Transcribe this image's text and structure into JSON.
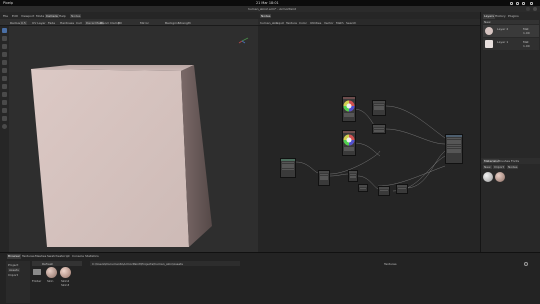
{
  "system_bar": {
    "app_menu": "Pixelp",
    "clock": "21 Mar 18:01"
  },
  "window": {
    "title": "human_skin2.arm* - ArmorPaint"
  },
  "menu": {
    "items": [
      "File",
      "Edit",
      "Viewport",
      "Mode",
      "Camera",
      "Help"
    ],
    "active_index": 4,
    "right_item": "Nodes",
    "search": "Search"
  },
  "tool_options": {
    "items": [
      "Radius",
      "0.5",
      "UV Layer",
      "Fade",
      "Hardness",
      "Cull",
      "Decal Mask",
      "Blend",
      "Clamp",
      "Fill"
    ],
    "right_items": [
      "Mirror",
      "Backgrnd",
      "Strength"
    ]
  },
  "node_editor": {
    "tabs": [
      "Nodes"
    ],
    "menu_items": [
      "human_skin",
      "Input",
      "Texture",
      "Color",
      "Utilities",
      "Vector",
      "Math",
      "Search"
    ],
    "active_tab": "Nodes"
  },
  "right_panel": {
    "tabs": [
      "Layers",
      "History",
      "Plugins"
    ],
    "layer_rows": [
      {
        "name": "Layer 2",
        "sub": "Mat",
        "opacity": "1.00"
      },
      {
        "name": "Layer 1",
        "sub": "Mat",
        "opacity": "1.00"
      }
    ],
    "materials_tabs": [
      "Materials",
      "Brushes",
      "Fonts"
    ],
    "materials_buttons": [
      "New",
      "Import",
      "Nodes"
    ]
  },
  "bottom_panel": {
    "tabs": [
      "Browser",
      "Textures",
      "Meshes",
      "Swatches",
      "Script",
      "Console",
      "Statistics"
    ],
    "active_index": 0,
    "left_buttons": [
      "Project",
      "Assets",
      "Import"
    ],
    "path_bar": "Refresh",
    "path": "C:\\Users\\Documents\\ArmorPaint\\Projects\\human_skin\\Assets",
    "status": "Textures",
    "files": [
      "Skin",
      "Skin2",
      "Skin3"
    ],
    "folder_label": "Folder"
  },
  "colors": {
    "background": "#1d1d1d",
    "panel": "#282828",
    "viewport": "#2e2e2e",
    "cube_face": "#d6c4c1",
    "accent": "#4a6fa5"
  },
  "icons": [
    "brush-icon",
    "eraser-icon",
    "fill-icon",
    "decal-icon",
    "text-icon",
    "clone-icon",
    "blur-icon",
    "smudge-icon",
    "particle-icon",
    "colorid-icon",
    "picker-icon",
    "bake-icon",
    "gizmo-icon",
    "folder-icon"
  ]
}
